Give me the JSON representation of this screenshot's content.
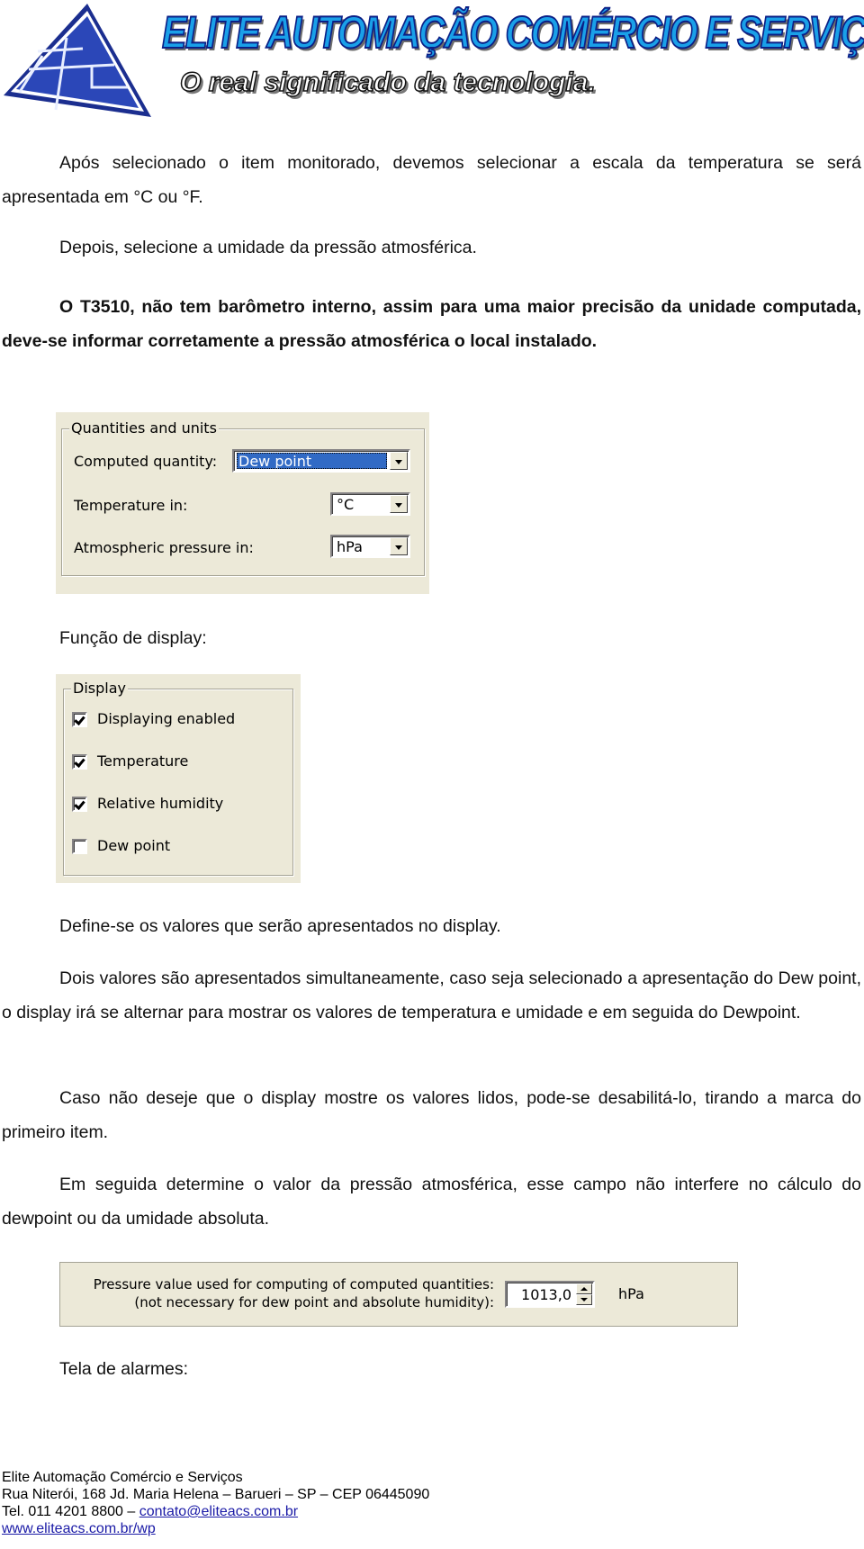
{
  "header": {
    "brand_title": "ELITE AUTOMAÇÃO COMÉRCIO E SERVIÇOS",
    "slogan": "O real significado da tecnologia.",
    "colors": {
      "brand_blue": "#1aa0e8",
      "brand_outline": "#0b1f86",
      "logo_blue": "#1b2e8f"
    }
  },
  "paragraphs": {
    "p1": "Após selecionado o item monitorado, devemos selecionar a escala da temperatura se será apresentada em °C ou °F.",
    "p2": "Depois, selecione a umidade da pressão atmosférica.",
    "p3": "O T3510, não tem barômetro interno, assim para uma maior precisão da unidade computada, deve-se informar corretamente a pressão atmosférica o local instalado.",
    "p4": "Função de display:",
    "p5": "Define-se os valores que serão apresentados no display.",
    "p6": "Dois valores são apresentados simultaneamente, caso seja selecionado a apresentação do Dew point, o display irá se alternar para mostrar os valores de temperatura e umidade e em seguida do Dewpoint.",
    "p7": "Caso não deseje que o display mostre os valores lidos, pode-se desabilitá-lo, tirando a marca do primeiro item.",
    "p8": "Em seguida determine o valor da pressão atmosférica, esse campo não interfere no cálculo do dewpoint ou da umidade absoluta.",
    "p9": "Tela de alarmes:"
  },
  "quantities_panel": {
    "group_title": "Quantities and units",
    "computed_quantity_label": "Computed quantity:",
    "computed_quantity_value": "Dew point",
    "temperature_label": "Temperature in:",
    "temperature_value": "°C",
    "pressure_label": "Atmospheric pressure in:",
    "pressure_value": "hPa",
    "selection_color": "#316ac5"
  },
  "display_panel": {
    "group_title": "Display",
    "items": [
      {
        "label": "Displaying enabled",
        "checked": true
      },
      {
        "label": "Temperature",
        "checked": true
      },
      {
        "label": "Relative humidity",
        "checked": true
      },
      {
        "label": "Dew point",
        "checked": false
      }
    ]
  },
  "pressure_panel": {
    "label_line1": "Pressure value used for computing of computed quantities:",
    "label_line2": "(not necessary for dew point and absolute humidity):",
    "value": "1013,0",
    "unit": "hPa"
  },
  "footer": {
    "company": "Elite Automação Comércio e Serviços",
    "address": "Rua Niterói, 168 Jd. Maria Helena – Barueri – SP – CEP 06445090",
    "phone_prefix": "Tel. 011 4201 8800 – ",
    "email": "contato@eliteacs.com.br",
    "website": "www.eliteacs.com.br/wp"
  }
}
